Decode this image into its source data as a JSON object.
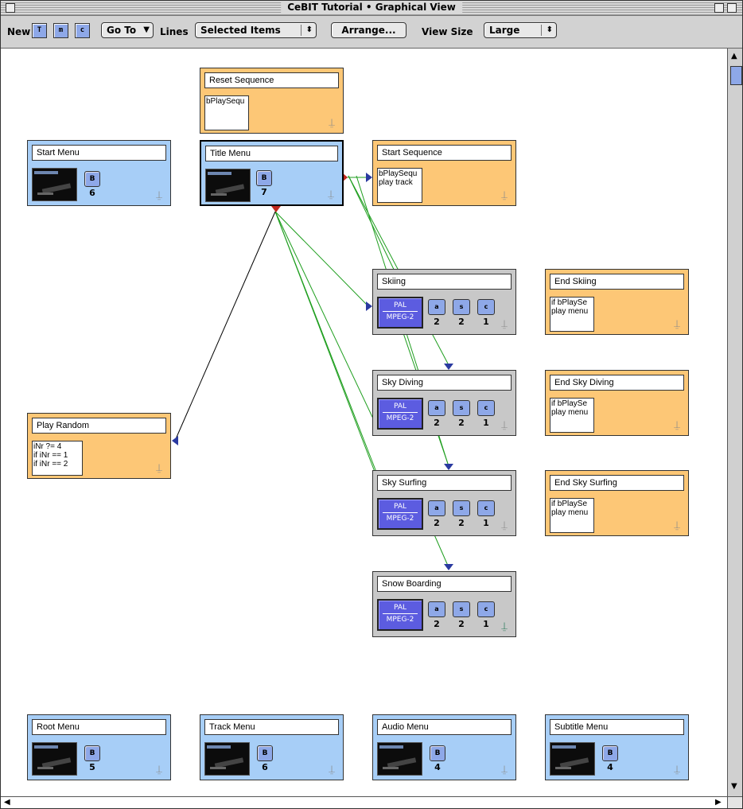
{
  "window": {
    "title": "CeBIT Tutorial • Graphical View"
  },
  "toolbar": {
    "new_label": "New",
    "new_buttons": [
      "T",
      "m",
      "c"
    ],
    "goto_label": "Go To",
    "lines_label": "Lines",
    "lines_value": "Selected Items",
    "arrange_label": "Arrange...",
    "viewsize_label": "View Size",
    "viewsize_value": "Large"
  },
  "nodes": {
    "reset_sequence": {
      "label": "Reset Sequence",
      "script": "bPlaySequ"
    },
    "start_menu": {
      "label": "Start Menu",
      "button": "B",
      "count": "6"
    },
    "title_menu": {
      "label": "Title Menu",
      "button": "B",
      "count": "7"
    },
    "start_sequence": {
      "label": "Start Sequence",
      "script": "bPlaySequ\nplay track"
    },
    "skiing": {
      "label": "Skiing",
      "video1": "PAL",
      "video2": "MPEG-2",
      "streams": [
        "a",
        "s",
        "c"
      ],
      "counts": [
        "2",
        "2",
        "1"
      ]
    },
    "end_skiing": {
      "label": "End Skiing",
      "script": "if bPlaySe\nplay menu"
    },
    "sky_diving": {
      "label": "Sky Diving",
      "video1": "PAL",
      "video2": "MPEG-2",
      "streams": [
        "a",
        "s",
        "c"
      ],
      "counts": [
        "2",
        "2",
        "1"
      ]
    },
    "end_sky_diving": {
      "label": "End Sky Diving",
      "script": "if bPlaySe\nplay menu"
    },
    "play_random": {
      "label": "Play Random",
      "script": "iNr ?= 4\nif iNr == 1\nif iNr == 2"
    },
    "sky_surfing": {
      "label": "Sky Surfing",
      "video1": "PAL",
      "video2": "MPEG-2",
      "streams": [
        "a",
        "s",
        "c"
      ],
      "counts": [
        "2",
        "2",
        "1"
      ]
    },
    "end_sky_surfing": {
      "label": "End Sky Surfing",
      "script": "if bPlaySe\nplay menu"
    },
    "snow_boarding": {
      "label": "Snow Boarding",
      "video1": "PAL",
      "video2": "MPEG-2",
      "streams": [
        "a",
        "s",
        "c"
      ],
      "counts": [
        "2",
        "2",
        "1"
      ]
    },
    "root_menu": {
      "label": "Root Menu",
      "button": "B",
      "count": "5"
    },
    "track_menu": {
      "label": "Track Menu",
      "button": "B",
      "count": "6"
    },
    "audio_menu": {
      "label": "Audio Menu",
      "button": "B",
      "count": "4"
    },
    "subtitle_menu": {
      "label": "Subtitle Menu",
      "button": "B",
      "count": "4"
    }
  },
  "colors": {
    "menu": "#a7cef7",
    "sequence": "#fdc776",
    "track": "#c8c8c8",
    "link_green": "#1e9e1e",
    "link_black": "#000000",
    "arrow_blue": "#2a3aa0"
  }
}
